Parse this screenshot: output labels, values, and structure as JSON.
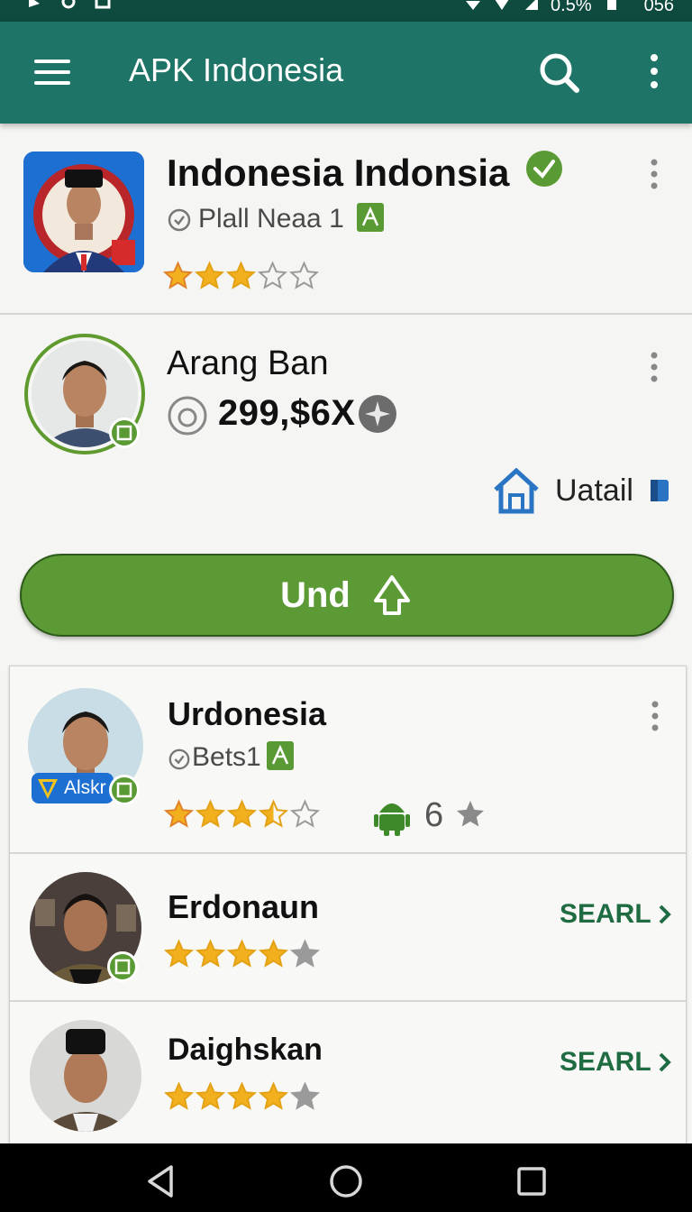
{
  "status_bar": {
    "battery": "0.5%",
    "time": "056"
  },
  "app_bar": {
    "title": "APK Indonesia",
    "icons": [
      "menu-icon",
      "search-icon",
      "more-vert-icon"
    ]
  },
  "featured_app": {
    "name": "Indonesia Indonsia",
    "subtitle": "Plall Neaa  1",
    "rating": 3,
    "rating_max": 5,
    "verified": true
  },
  "developer": {
    "name": "Arang Ban",
    "count": "299,$6X",
    "detail_label": "Uatail"
  },
  "install_button": {
    "label": "Und"
  },
  "list": [
    {
      "name": "Urdonesia",
      "subtitle": "Bets1",
      "tag": "Alskr",
      "rating": 3.5,
      "extra_count": "6"
    },
    {
      "name": "Erdonaun",
      "action": "SEARL",
      "rating": 4
    },
    {
      "name": "Daighskan",
      "action": "SEARL",
      "rating": 4
    }
  ],
  "colors": {
    "status_bar": "#0f4a3e",
    "app_bar": "#1e7466",
    "accent_green": "#5c9a35",
    "link_green": "#1f6b42",
    "star": "#f2b01e"
  }
}
